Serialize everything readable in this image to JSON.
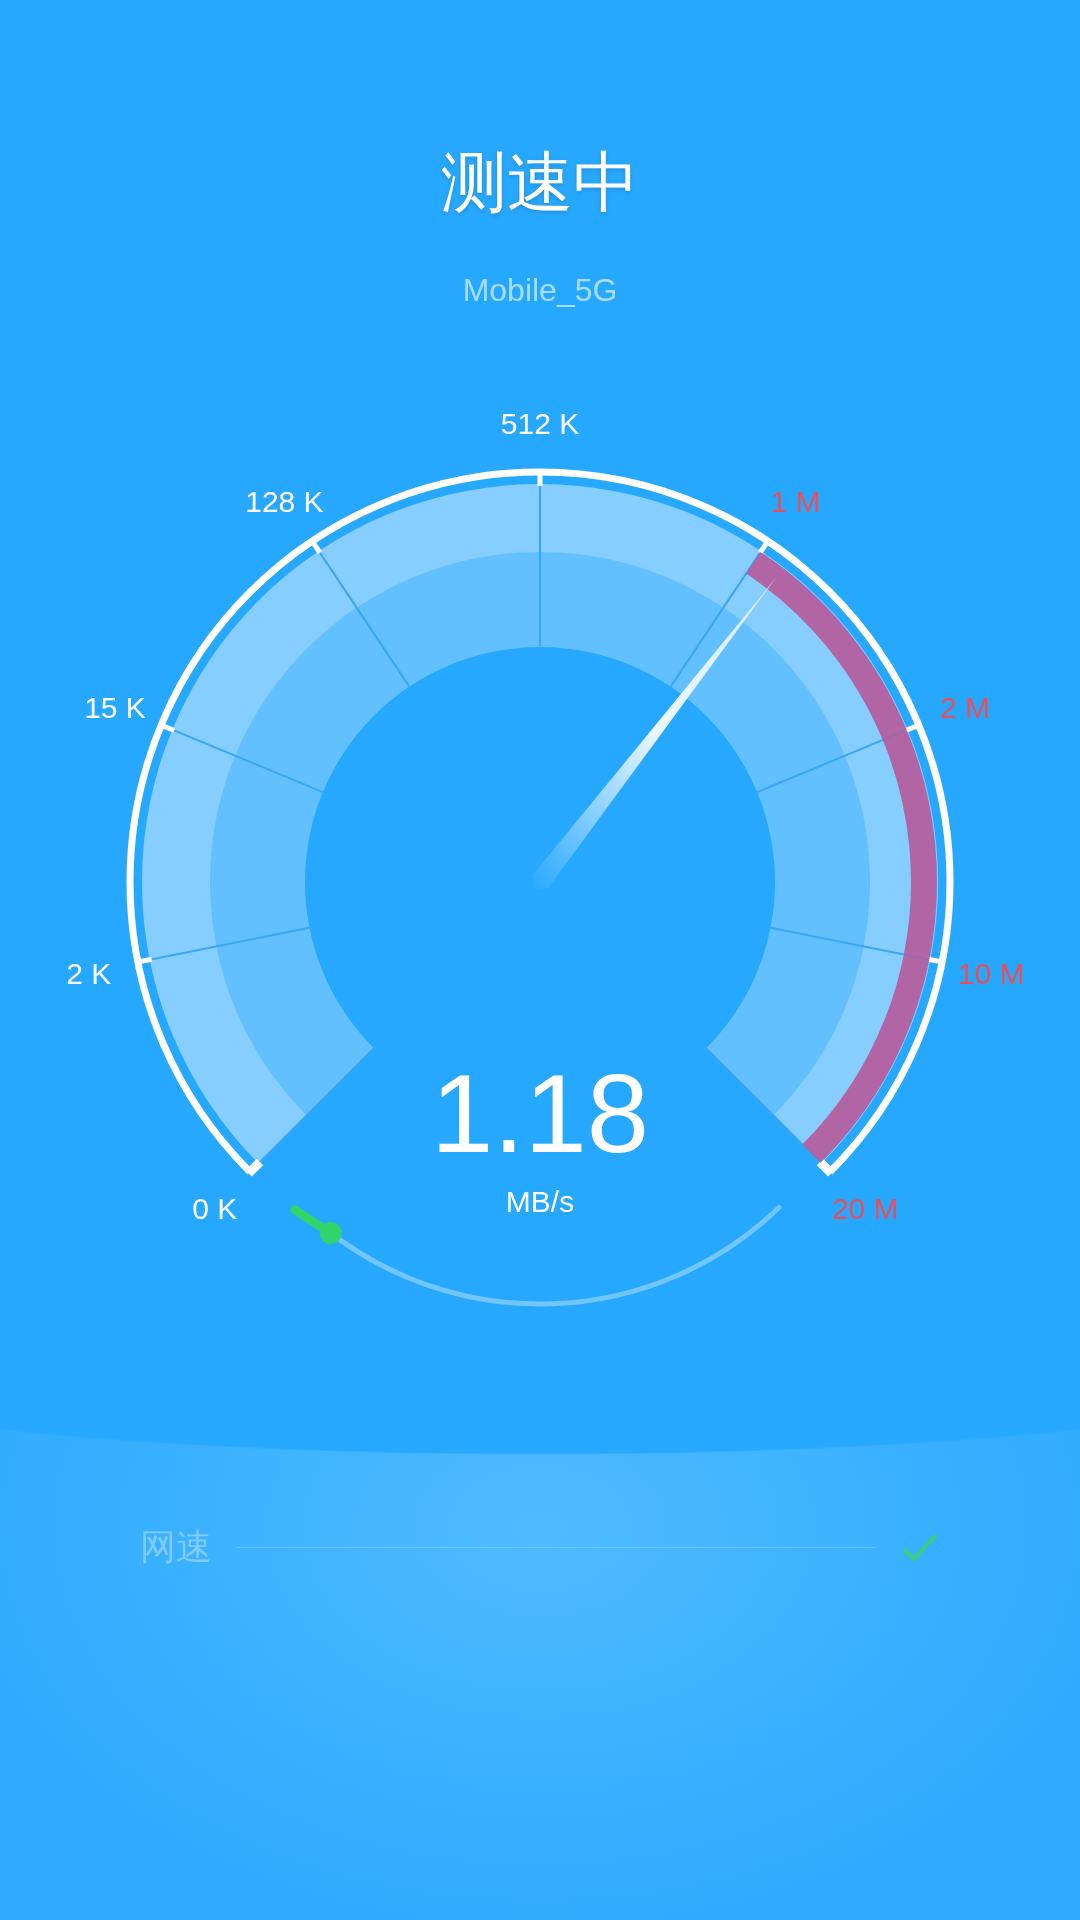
{
  "header": {
    "title": "测速中",
    "network": "Mobile_5G"
  },
  "gauge": {
    "ticks": [
      {
        "label": "0 K",
        "color": "#ffffff"
      },
      {
        "label": "2 K",
        "color": "#ffffff",
        "alert": false
      },
      {
        "label": "15 K",
        "color": "#ffffff",
        "alert": false
      },
      {
        "label": "128 K",
        "color": "#ffffff",
        "alert": false
      },
      {
        "label": "512 K",
        "color": "#ffffff",
        "alert": false
      },
      {
        "label": "1 M",
        "color": "#e5505c",
        "alert": false
      },
      {
        "label": "2 M",
        "color": "#e5505c",
        "alert": true
      },
      {
        "label": "10 M",
        "color": "#e5505c",
        "alert": true
      },
      {
        "label": "20 M",
        "color": "#e5505c",
        "alert": true
      }
    ],
    "needle": {
      "level": 0.64
    },
    "reading": "1.18",
    "unit": "MB/s",
    "progress": {
      "level": 0.03
    }
  },
  "results": [
    {
      "label": "网速",
      "done": true
    }
  ]
}
